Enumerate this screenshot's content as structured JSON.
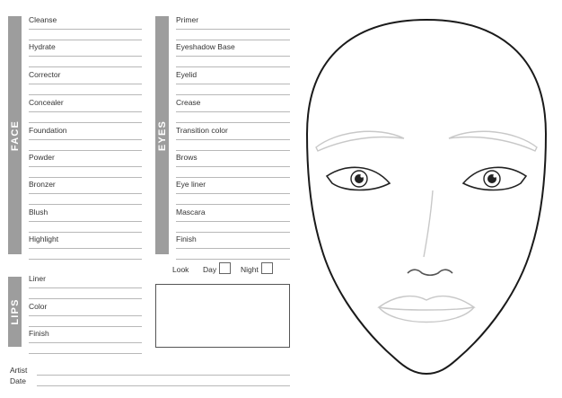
{
  "sections": {
    "face": {
      "title": "FACE",
      "items": [
        "Cleanse",
        "Hydrate",
        "Corrector",
        "Concealer",
        "Foundation",
        "Powder",
        "Bronzer",
        "Blush",
        "Highlight"
      ]
    },
    "eyes": {
      "title": "EYES",
      "items": [
        "Primer",
        "Eyeshadow Base",
        "Eyelid",
        "Crease",
        "Transition color",
        "Brows",
        "Eye liner",
        "Mascara",
        "Finish"
      ]
    },
    "lips": {
      "title": "LIPS",
      "items": [
        "Liner",
        "Color",
        "Finish"
      ]
    }
  },
  "look": {
    "label": "Look",
    "day_label": "Day",
    "night_label": "Night"
  },
  "footer": {
    "artist_label": "Artist",
    "date_label": "Date"
  }
}
